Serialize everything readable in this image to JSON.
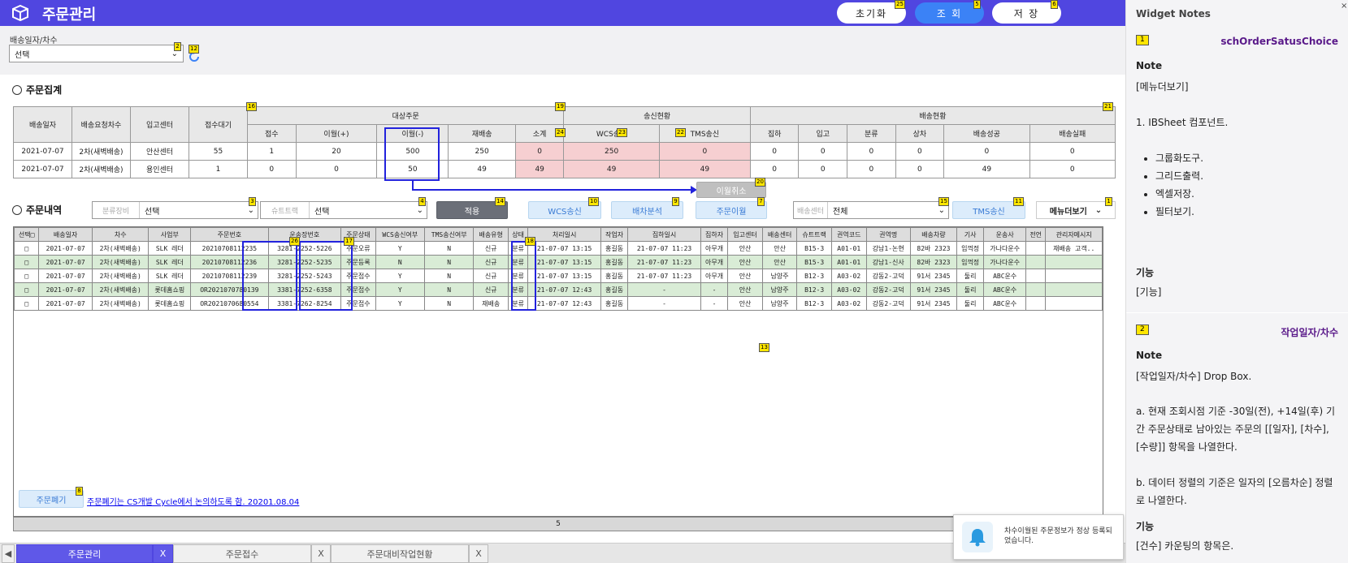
{
  "header": {
    "title": "주문관리",
    "buttons": {
      "reset": "초기화",
      "search": "조 회",
      "save": "저 장"
    }
  },
  "filter": {
    "label": "배송일자/차수",
    "value": "선택"
  },
  "summary": {
    "title": "주문집계",
    "headers": {
      "date": "배송일자",
      "round": "배송요청차수",
      "center": "입고센터",
      "wait": "접수대기",
      "target": "대상주문",
      "send": "송신현황",
      "delivery": "배송현황"
    },
    "sub": [
      "접수",
      "이월(+)",
      "이월(-)",
      "재배송",
      "소계",
      "WCS송신",
      "TMS송신",
      "집하",
      "입고",
      "분류",
      "상차",
      "배송성공",
      "배송실패"
    ],
    "rows": [
      [
        "2021-07-07",
        "2차(새벽배송)",
        "안산센터",
        "55",
        "1",
        "20",
        "500",
        "250",
        "0",
        "250",
        "0",
        "0",
        "0",
        "0",
        "0",
        "0",
        "0"
      ],
      [
        "2021-07-07",
        "2차(새벽배송)",
        "용인센터",
        "1",
        "0",
        "0",
        "50",
        "49",
        "49",
        "49",
        "49",
        "0",
        "0",
        "0",
        "0",
        "49",
        "0"
      ]
    ],
    "cancel": "이월취소"
  },
  "detail": {
    "title": "주문내역",
    "sorter_label": "분류장비",
    "sorter_value": "선택",
    "chute_label": "슈트트랙",
    "chute_value": "선택",
    "apply": "적용",
    "wcs": "WCS송신",
    "dispatch": "배차분석",
    "carry": "주문이월",
    "center_label": "배송센터",
    "center_value": "전체",
    "tms": "TMS송신",
    "menu": "메뉴더보기",
    "columns": [
      "선택□",
      "배송일자",
      "차수",
      "사업부",
      "주문번호",
      "운송장번호",
      "주문상태",
      "WCS송신여부",
      "TMS송신여부",
      "배송유형",
      "상태",
      "처리일시",
      "작업자",
      "집하일시",
      "집하자",
      "입고센터",
      "배송센터",
      "슈트트랙",
      "권역코드",
      "권역명",
      "배송차량",
      "기사",
      "운송사",
      "전언",
      "관리자메시지"
    ],
    "rows": [
      [
        "□",
        "2021-07-07",
        "2차(새벽배송)",
        "SLK 레더",
        "20210708112235",
        "3281-2252-5226",
        "주문오류",
        "Y",
        "N",
        "신규",
        "분류",
        "21-07-07 13:15",
        "홍길동",
        "21-07-07 11:23",
        "아무개",
        "안산",
        "안산",
        "B15-3",
        "A01-01",
        "강남1-논현",
        "82바 2323",
        "임꺽정",
        "가나다운수",
        "",
        "재배송 고객.."
      ],
      [
        "□",
        "2021-07-07",
        "2차(새벽배송)",
        "SLK 레더",
        "20210708112236",
        "3281-2252-5235",
        "주문등록",
        "N",
        "N",
        "신규",
        "분류",
        "21-07-07 13:15",
        "홍길동",
        "21-07-07 11:23",
        "아무개",
        "안산",
        "안산",
        "B15-3",
        "A01-01",
        "강남1-신사",
        "82바 2323",
        "임꺽정",
        "가나다운수",
        "",
        ""
      ],
      [
        "□",
        "2021-07-07",
        "2차(새벽배송)",
        "SLK 레더",
        "20210708112239",
        "3281-2252-5243",
        "주문접수",
        "Y",
        "N",
        "신규",
        "분류",
        "21-07-07 13:15",
        "홍길동",
        "21-07-07 11:23",
        "아무개",
        "안산",
        "남양주",
        "B12-3",
        "A03-02",
        "강동2-고덕",
        "91서 2345",
        "둘리",
        "ABC운수",
        "",
        ""
      ],
      [
        "□",
        "2021-07-07",
        "2차(새벽배송)",
        "롯데홈쇼핑",
        "OR2021070780139",
        "3381-7252-6358",
        "주문접수",
        "Y",
        "N",
        "신규",
        "분류",
        "21-07-07 12:43",
        "홍길동",
        "-",
        "-",
        "안산",
        "남양주",
        "B12-3",
        "A03-02",
        "강동2-고덕",
        "91서 2345",
        "둘리",
        "ABC운수",
        "",
        ""
      ],
      [
        "□",
        "2021-07-07",
        "2차(새벽배송)",
        "롯데홈쇼핑",
        "OR2021070680554",
        "3381-7262-8254",
        "주문접수",
        "Y",
        "N",
        "재배송",
        "분류",
        "21-07-07 12:43",
        "홍길동",
        "-",
        "-",
        "안산",
        "남양주",
        "B12-3",
        "A03-02",
        "강동2-고덕",
        "91서 2345",
        "둘리",
        "ABC운수",
        "",
        ""
      ]
    ],
    "discard": "주문폐기",
    "note_link": "주문폐기는 CS개발 Cycle에서 논의하도록 함. 20201.08.04",
    "footer_count": "5"
  },
  "tabs": [
    {
      "label": "주문관리",
      "close": "X"
    },
    {
      "label": "주문접수",
      "close": "X"
    },
    {
      "label": "주문대비작업현황",
      "close": "X"
    }
  ],
  "toast": {
    "text": "차수이월된 주문정보가 정상 등록되었습니다."
  },
  "notes": {
    "title": "Widget Notes",
    "n1": {
      "num": "1",
      "name": "schOrderSatusChoice",
      "note_label": "Note",
      "note": "[메뉴더보기]",
      "l1": "1. IBSheet 컴포넌트.",
      "bullets": [
        "그룹화도구.",
        "그리드출력.",
        "엑셀저장.",
        "필터보기."
      ],
      "func_label": "기능",
      "func": "[기능]"
    },
    "n2": {
      "num": "2",
      "name": "작업일자/차수",
      "note_label": "Note",
      "note": "[작업일자/차수] Drop Box.",
      "a": "a. 현재 조회시점 기준 -30일(전), +14일(후) 기간 주문상태로 남아있는 주문의 [[일자], [차수], [수량]] 항목을 나열한다.",
      "b": "b. 데이터 정렬의 기준은 일자의 [오름차순] 정렬로 나열한다.",
      "func_label": "기능",
      "func": "[건수] 카운팅의 항목은."
    }
  },
  "colors": {
    "header": "#5046e0",
    "accent": "#3b82f6",
    "note_purple": "#5a1a8a",
    "pink": "#f6cfd1",
    "green_row": "#d9ecd6",
    "highlight": "#2222dd"
  }
}
